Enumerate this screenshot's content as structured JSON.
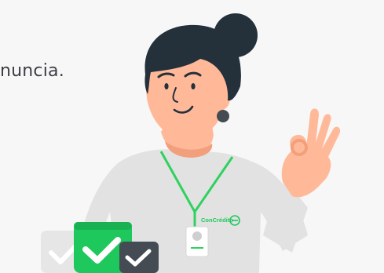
{
  "intro": {
    "text_fragment": "nuncia."
  },
  "illustration": {
    "badge_logo_text": "ConCrédito",
    "checkmarks": [
      {
        "state": "faded",
        "color": "#e6e6e6"
      },
      {
        "state": "active",
        "color": "#1fc85c"
      },
      {
        "state": "dark",
        "color": "#444b53"
      }
    ],
    "colors": {
      "background": "#f7f7f7",
      "hair": "#24303a",
      "skin": "#ffb998",
      "shirt": "#e2e2e2",
      "lanyard": "#2fd15f",
      "accent_green": "#1fc85c",
      "dark_gray": "#444b53"
    }
  }
}
